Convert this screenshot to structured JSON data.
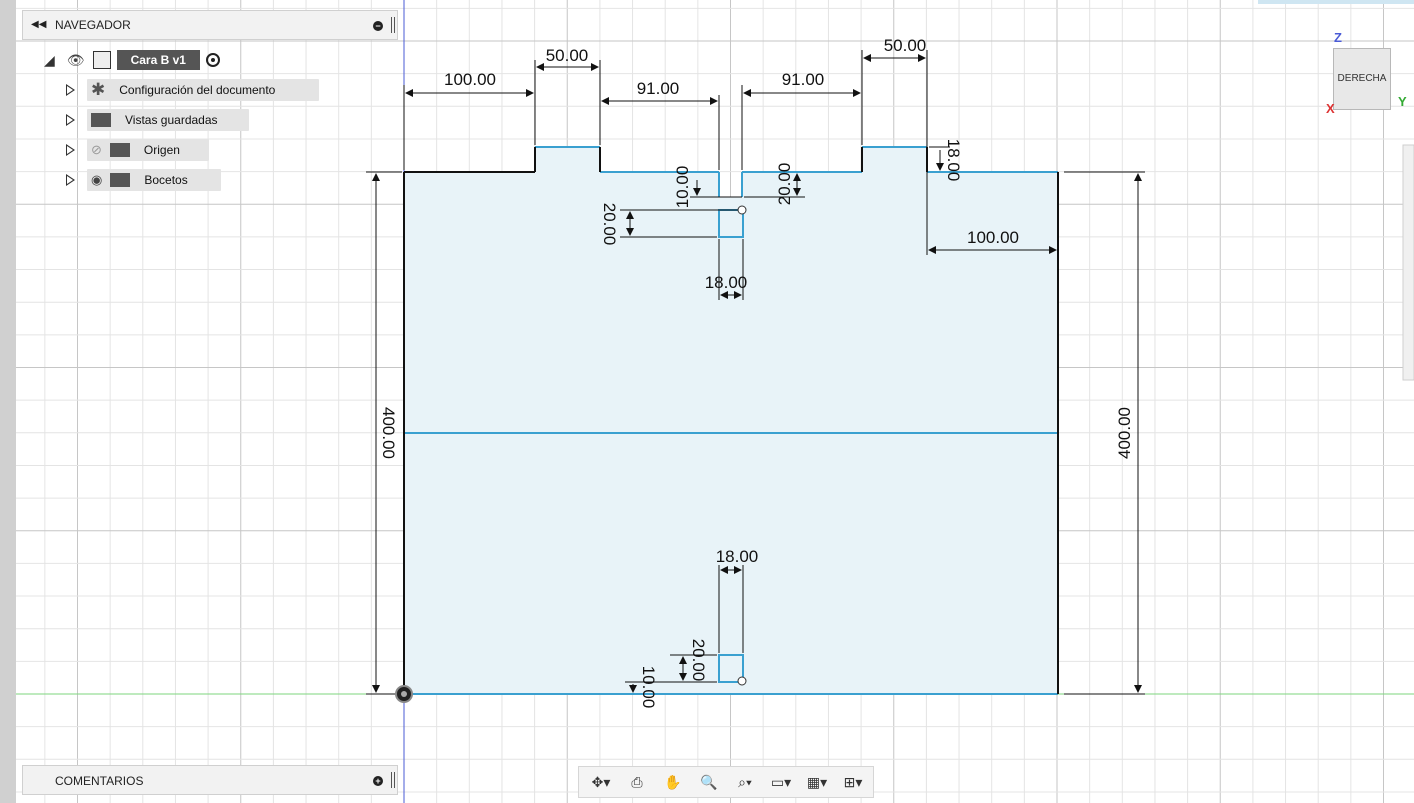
{
  "navigator": {
    "title": "NAVEGADOR",
    "root_label": "Cara B v1",
    "items": [
      {
        "label": "Configuración del documento",
        "icon": "gear-icon"
      },
      {
        "label": "Vistas guardadas",
        "icon": "folder-icon"
      },
      {
        "label": "Origen",
        "icon": "folder-icon"
      },
      {
        "label": "Bocetos",
        "icon": "folder-icon"
      }
    ]
  },
  "comments": {
    "title": "COMENTARIOS"
  },
  "viewcube": {
    "face": "DERECHA",
    "axis_z": "Z",
    "axis_x": "X",
    "axis_y": "Y"
  },
  "dimensions": {
    "top_left_100": "100.00",
    "top_left_50": "50.00",
    "top_left_91": "91.00",
    "top_right_91": "91.00",
    "top_right_50": "50.00",
    "right_100": "100.00",
    "right_18": "18.00",
    "mid_10": "10.00",
    "mid_20_left": "20.00",
    "mid_20_right": "20.00",
    "mid_18": "18.00",
    "left_400": "400.00",
    "right_400": "400.00",
    "bottom_18": "18.00",
    "bottom_20": "20.00",
    "bottom_10": "10.00"
  },
  "toolbar": [
    "orbit-icon",
    "look-at-icon",
    "pan-icon",
    "zoom-icon",
    "fit-icon",
    "display-icon",
    "grid-icon",
    "viewports-icon"
  ],
  "colors": {
    "sketch_fill": "#e8f3f8",
    "sketch_line": "#3aa0d0",
    "grid": "#d8d8d8",
    "axis_green": "#7ed67e"
  }
}
